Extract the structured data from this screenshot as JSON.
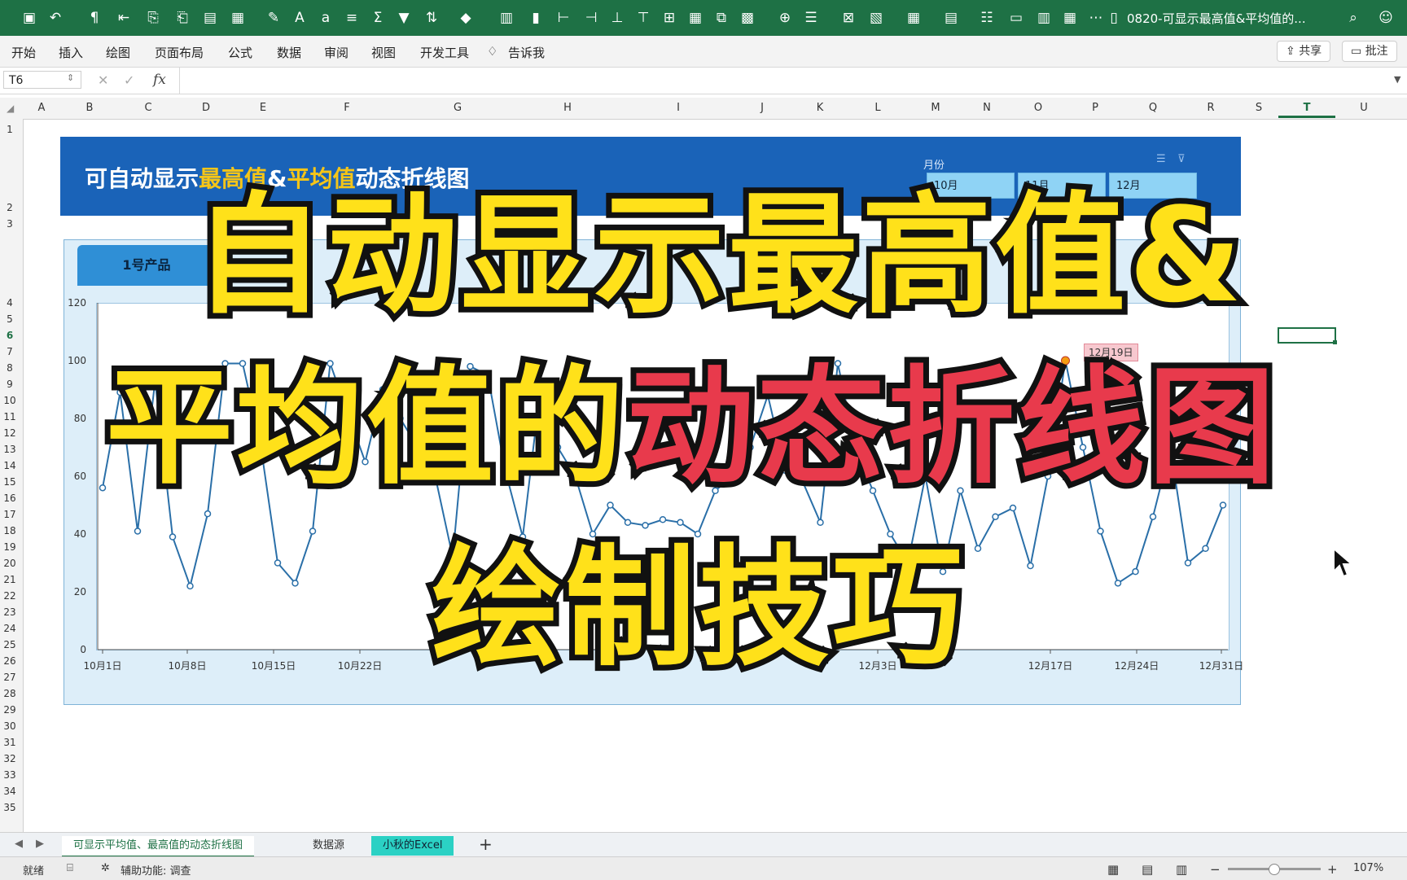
{
  "window": {
    "title": "0820-可显示最高值&平均值的..."
  },
  "ribbon": {
    "tabs": [
      "开始",
      "插入",
      "绘图",
      "页面布局",
      "公式",
      "数据",
      "审阅",
      "视图",
      "开发工具",
      "告诉我"
    ],
    "share_label": "共享",
    "comment_label": "批注"
  },
  "formula_bar": {
    "cell_ref": "T6",
    "fx_label": "fx",
    "value": ""
  },
  "columns": [
    "A",
    "B",
    "C",
    "D",
    "E",
    "F",
    "G",
    "H",
    "I",
    "J",
    "K",
    "L",
    "M",
    "N",
    "O",
    "P",
    "Q",
    "R",
    "S",
    "T",
    "U"
  ],
  "rows": [
    "1",
    "2",
    "3",
    "4",
    "5",
    "6",
    "7",
    "8",
    "9",
    "10",
    "11",
    "12",
    "13",
    "14",
    "15",
    "16",
    "17",
    "18",
    "19",
    "20",
    "21",
    "22",
    "23",
    "24",
    "25",
    "26",
    "27",
    "28",
    "29",
    "30",
    "31",
    "32",
    "33",
    "34",
    "35"
  ],
  "dashboard": {
    "title_part1": "可自动显示",
    "title_highlight1": "最高值",
    "title_amp": "&",
    "title_highlight2": "平均值",
    "title_part2": "动态折线图",
    "month_filter_label": "月份",
    "month_options": [
      "10月",
      "11月",
      "12月"
    ],
    "product_tab": "1号产品",
    "peak_label": "12月19日"
  },
  "overlay": {
    "line1": "自动显示最高值&",
    "line2_a": "平均值的",
    "line2_b": "动态折线图",
    "line3": "绘制技巧"
  },
  "chart_data": {
    "type": "line",
    "y_ticks": [
      "0",
      "20",
      "40",
      "60",
      "80",
      "100",
      "120"
    ],
    "ylim": [
      0,
      120
    ],
    "x_tick_labels": [
      "10月1日",
      "10月8日",
      "10月15日",
      "10月22日",
      "12月3日",
      "12月17日",
      "12月24日",
      "12月31日"
    ],
    "grid": false,
    "series": [
      {
        "values": [
          56,
          89,
          41,
          93,
          39,
          22,
          47,
          99,
          99,
          72,
          30,
          23,
          41,
          99,
          82,
          65,
          90,
          80,
          70,
          60,
          32,
          98,
          95,
          62,
          39,
          90,
          70,
          60,
          40,
          50,
          44,
          43,
          45,
          44,
          40,
          55,
          60,
          70,
          88,
          62,
          58,
          44,
          99,
          70,
          55,
          40,
          30,
          60,
          27,
          55,
          35,
          46,
          49,
          29,
          60,
          100,
          70,
          41,
          23,
          27,
          46,
          70,
          30,
          35,
          50
        ]
      }
    ]
  },
  "sheet_tabs": [
    "可显示平均值、最高值的动态折线图",
    "数据源",
    "小秋的Excel"
  ],
  "status": {
    "ready": "就绪",
    "accessibility": "辅助功能: 调查",
    "zoom": "107%"
  },
  "colors": {
    "excel_green": "#1e7145",
    "header_blue": "#1a63b8",
    "title_yellow": "#f5c518",
    "overlay_yellow": "#ffe11a",
    "overlay_red": "#e83a4c",
    "line_blue": "#2a6fa8"
  }
}
